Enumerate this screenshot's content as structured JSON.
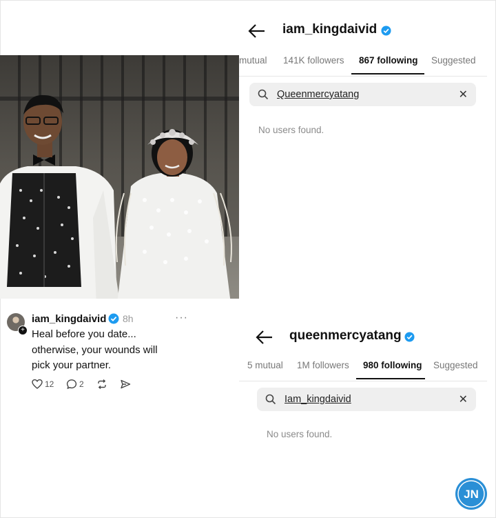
{
  "post": {
    "username": "iam_kingdaivid",
    "time": "8h",
    "lines": [
      "Heal before you date...",
      "otherwise, your wounds will",
      "pick your partner."
    ],
    "likes": "12",
    "replies": "2"
  },
  "profile_top": {
    "username": "iam_kingdaivid",
    "tabs": {
      "mutual": "mutual",
      "followers": "141K followers",
      "following": "867 following",
      "suggested": "Suggested"
    },
    "search_query": "Queenmercyatang",
    "empty_message": "No users found."
  },
  "profile_bottom": {
    "username": "queenmercyatang",
    "tabs": {
      "mutual": "5 mutual",
      "followers": "1M followers",
      "following": "980 following",
      "suggested": "Suggested"
    },
    "search_query": "Iam_kingdaivid",
    "empty_message": "No users found."
  },
  "watermark": {
    "text": "JN"
  },
  "colors": {
    "verified": "#1d9bf0",
    "logo": "#2a8fd6"
  }
}
